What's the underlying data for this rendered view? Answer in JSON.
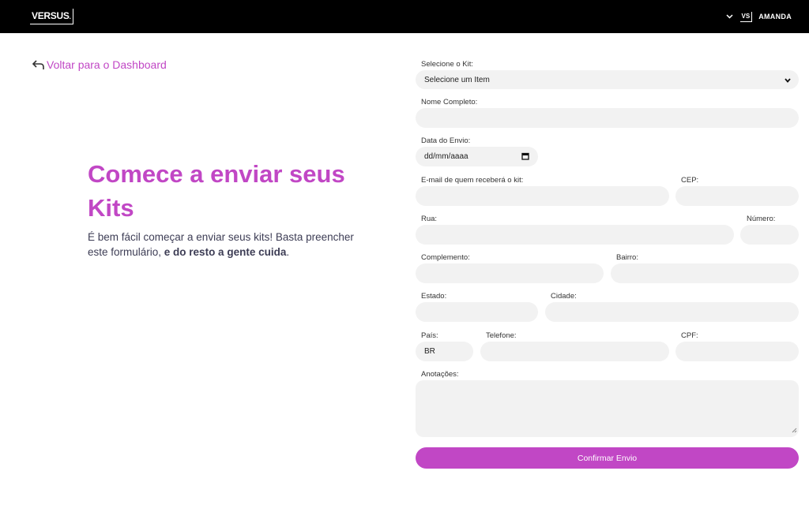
{
  "header": {
    "logo_text": "VERSUS",
    "badge_text": "VS",
    "user_name": "AMANDA",
    "menu_icon": "chevron-down-icon"
  },
  "back_link": {
    "label": "Voltar para o Dashboard",
    "icon": "return-arrow-icon"
  },
  "hero": {
    "title": "Comece a enviar seus Kits",
    "desc_plain": "É bem fácil começar a enviar seus kits! Basta preencher este formulário, ",
    "desc_bold": "e do resto a gente cuida",
    "desc_end": "."
  },
  "form": {
    "kit": {
      "label": "Selecione o Kit:",
      "value": "Selecione um Item"
    },
    "nome": {
      "label": "Nome Completo:",
      "value": ""
    },
    "data": {
      "label": "Data do Envio:",
      "value": "dd/mm/aaaa"
    },
    "email": {
      "label": "E-mail de quem receberá o kit:",
      "value": ""
    },
    "cep": {
      "label": "CEP:",
      "value": ""
    },
    "rua": {
      "label": "Rua:",
      "value": ""
    },
    "numero": {
      "label": "Número:",
      "value": ""
    },
    "complemento": {
      "label": "Complemento:",
      "value": ""
    },
    "bairro": {
      "label": "Bairro:",
      "value": ""
    },
    "estado": {
      "label": "Estado:",
      "value": ""
    },
    "cidade": {
      "label": "Cidade:",
      "value": ""
    },
    "pais": {
      "label": "País:",
      "value": "BR"
    },
    "telefone": {
      "label": "Telefone:",
      "value": ""
    },
    "cpf": {
      "label": "CPF:",
      "value": ""
    },
    "anotacoes": {
      "label": "Anotações:",
      "value": ""
    },
    "submit_label": "Confirmar Envio"
  },
  "colors": {
    "accent": "#c147c5",
    "header_bg": "#000000",
    "field_bg": "#f2f2f2",
    "text_dark": "#3d3d55"
  }
}
